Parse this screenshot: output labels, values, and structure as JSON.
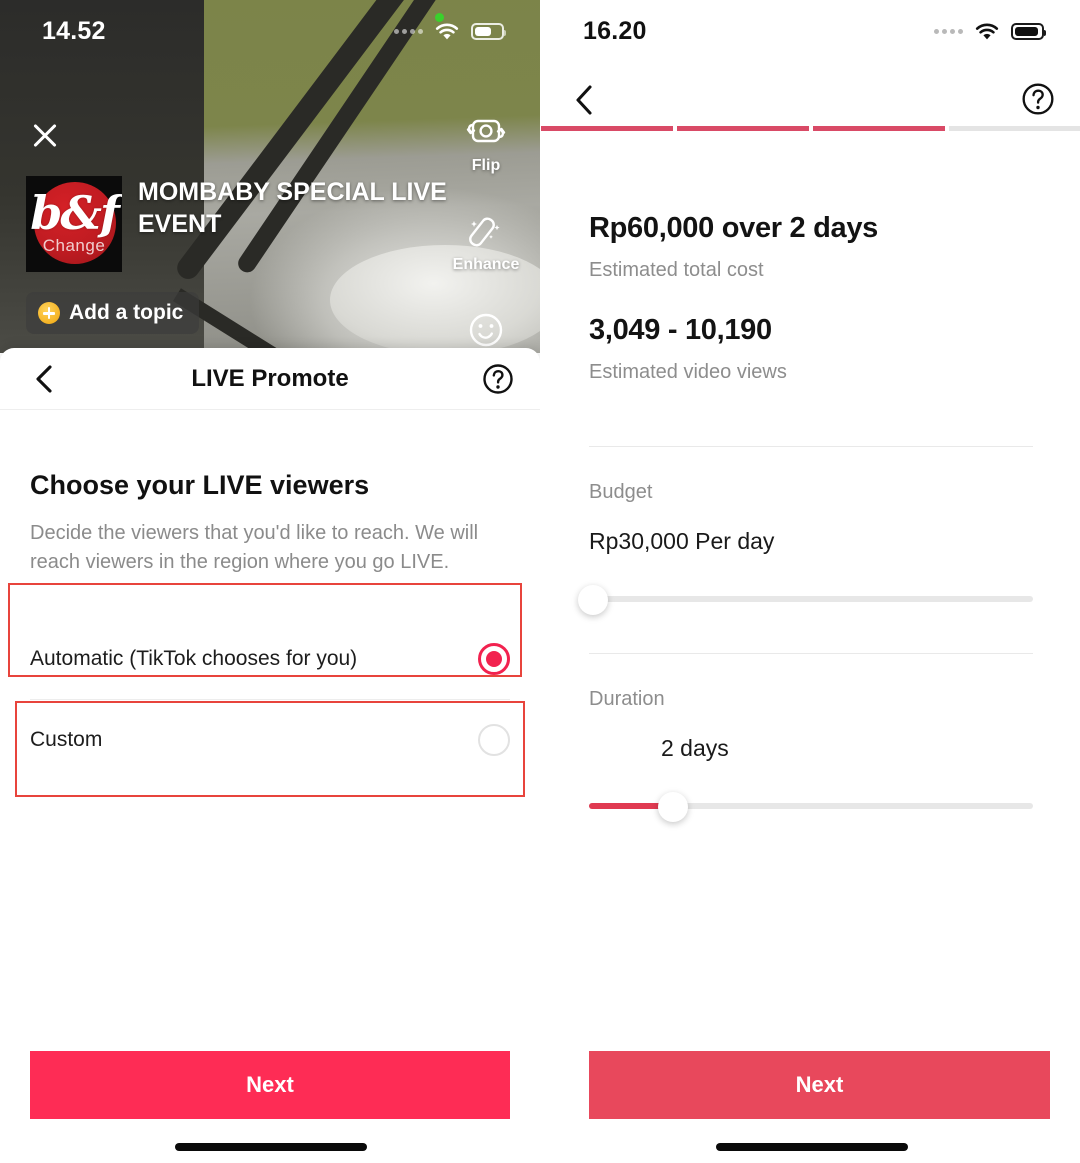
{
  "left": {
    "status": {
      "time": "14.52",
      "wifi_icon": "wifi-icon",
      "battery_icon": "battery-icon",
      "recording_indicator": "green-recording-dot"
    },
    "camera": {
      "close_icon": "close-icon",
      "avatar_logo_text": "b&f",
      "avatar_change_label": "Change",
      "live_title": "MOMBABY SPECIAL LIVE EVENT",
      "topic_button": "Add a topic",
      "topic_plus_icon": "plus-circle-icon",
      "tools": [
        {
          "icon": "flip-camera-icon",
          "label": "Flip"
        },
        {
          "icon": "magic-wand-icon",
          "label": "Enhance"
        },
        {
          "icon": "smiley-face-icon",
          "label": "Effects"
        }
      ]
    },
    "sheet": {
      "back_icon": "back-chevron-icon",
      "title": "LIVE Promote",
      "help_icon": "help-circle-icon",
      "heading": "Choose your LIVE viewers",
      "description": "Decide the viewers that you'd like to reach. We will reach viewers in the region where you go LIVE.",
      "options": [
        {
          "label": "Automatic (TikTok chooses for you)",
          "selected": true
        },
        {
          "label": "Custom",
          "selected": false
        }
      ]
    },
    "cta": "Next"
  },
  "right": {
    "status": {
      "time": "16.20",
      "wifi_icon": "wifi-icon",
      "battery_icon": "battery-icon"
    },
    "header": {
      "back_icon": "back-chevron-icon",
      "help_icon": "help-circle-icon"
    },
    "progress": {
      "total_steps": 4,
      "completed_steps": 3
    },
    "summary": {
      "total_cost": "Rp60,000 over 2 days",
      "total_cost_label": "Estimated total cost",
      "views_range": "3,049 - 10,190",
      "views_label": "Estimated video views"
    },
    "budget": {
      "label": "Budget",
      "value": "Rp30,000 Per day",
      "slider_percent": 1
    },
    "duration": {
      "label": "Duration",
      "value": "2 days",
      "slider_percent": 19
    },
    "cta": "Next"
  },
  "colors": {
    "brand_red": "#fe2c55",
    "cta_right_red": "#e8485c",
    "progress_red": "#d94a66",
    "slider_red": "#e03a51",
    "annotation_red": "#e8443c",
    "muted_text": "#8d8d8d"
  }
}
